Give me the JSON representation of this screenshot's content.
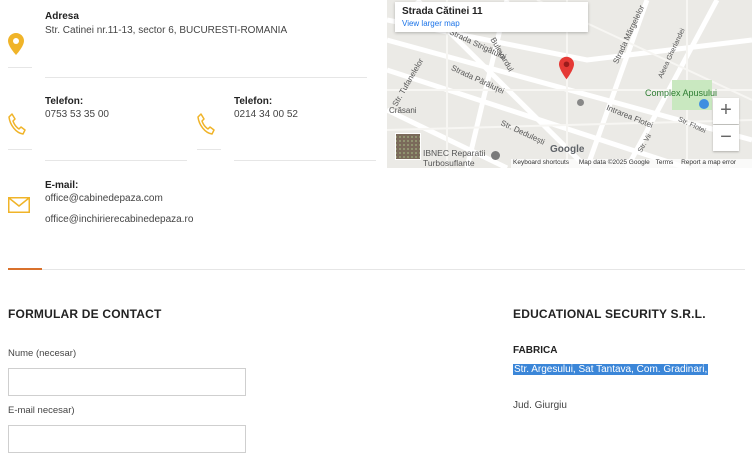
{
  "address": {
    "label": "Adresa",
    "value": "Str. Catinei nr.11-13, sector 6, BUCURESTI-ROMANIA"
  },
  "phone1": {
    "label": "Telefon:",
    "value": "0753 53 35 00"
  },
  "phone2": {
    "label": "Telefon:",
    "value": "0214 34 00 52"
  },
  "email": {
    "label": "E-mail:",
    "values": [
      "office@cabinedepaza.com",
      "office@inchirierecabinedepaza.ro"
    ]
  },
  "map": {
    "place_title": "Strada Cătinei 11",
    "view_larger": "View larger map",
    "zoom_in": "+",
    "zoom_out": "−",
    "streets": [
      "Strada Strigătului",
      "Strada Părăluței",
      "Bulevardul",
      "Str. Tufanelelor",
      "Strada Mărgelelor",
      "Aleea Gherlandei",
      "Intrarea Flotei",
      "Str. Flotei",
      "Str. Dedulești",
      "Crăsani",
      "Str. Vii"
    ],
    "poi_park": "Complex Apusului",
    "poi_business": "IBNEC Reparatii Turbosuflante",
    "google": "Google",
    "footer": [
      "Keyboard shortcuts",
      "Map data ©2025 Google",
      "Terms",
      "Report a map error"
    ]
  },
  "form": {
    "heading": "FORMULAR DE CONTACT",
    "name_label": "Nume (necesar)",
    "email_label": "E-mail necesar)"
  },
  "company": {
    "name": "EDUCATIONAL SECURITY S.R.L.",
    "section": "FABRICA",
    "address_line": "Str. Argesului, Sat Tantava, Com. Gradinari,",
    "county": "Jud. Giurgiu"
  },
  "colors": {
    "accent": "#f0b429",
    "divider_accent": "#d9712c",
    "selection": "#3b86d8",
    "map_pin": "#e53935"
  }
}
